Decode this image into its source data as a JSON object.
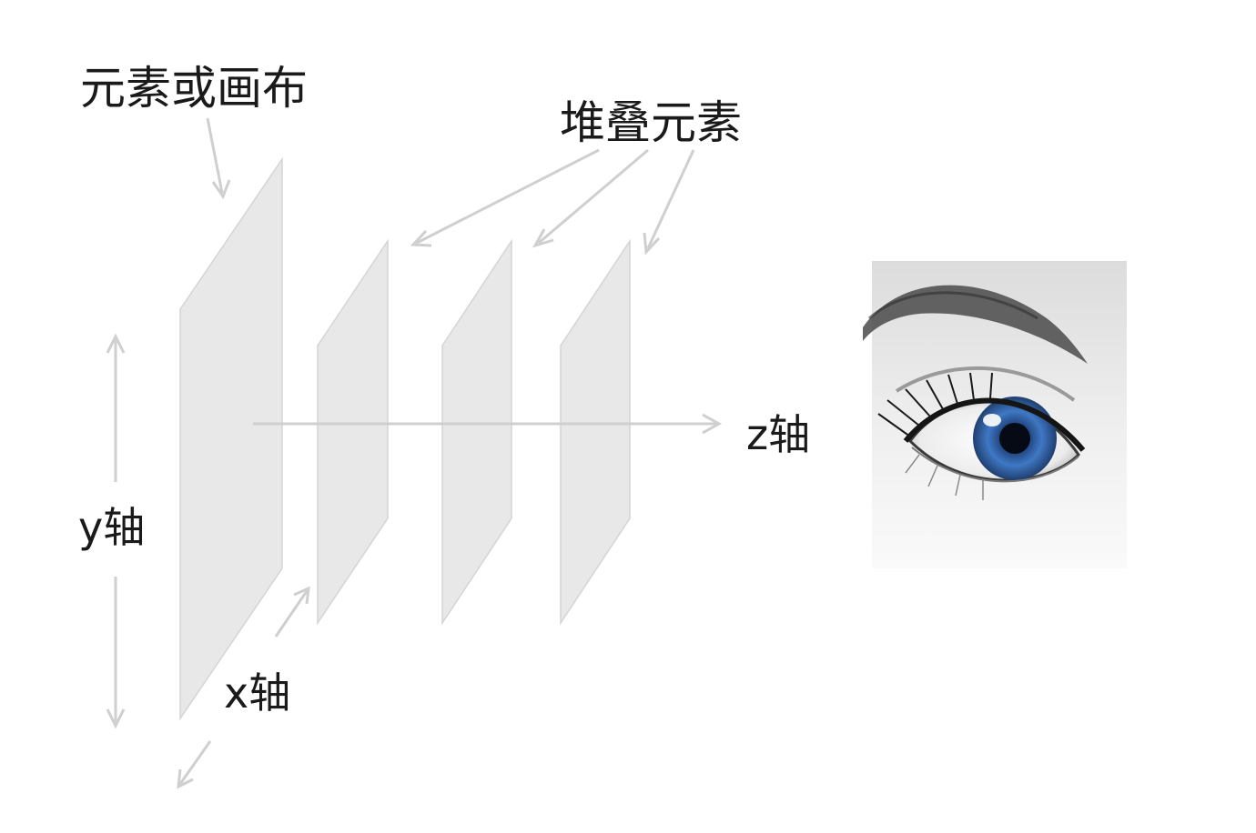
{
  "labels": {
    "canvas": "元素或画布",
    "stacked": "堆叠元素",
    "z_axis": "z轴",
    "y_axis": "y轴",
    "x_axis": "x轴"
  },
  "colors": {
    "plane_fill": "#e8e8e8",
    "arrow": "#cfcfcf",
    "text": "#1a1a1a",
    "iris": "#3f78c4"
  },
  "image": {
    "icon": "eye-photo"
  }
}
